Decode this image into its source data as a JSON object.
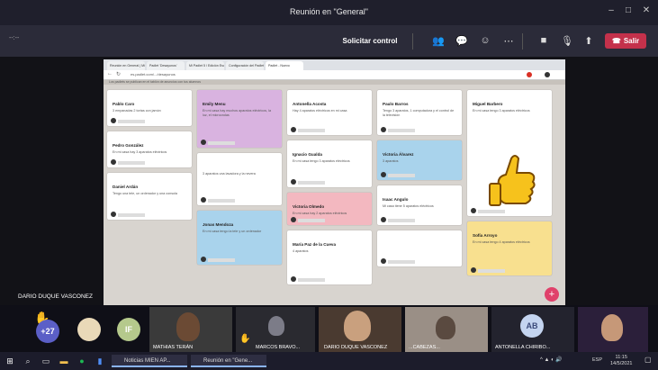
{
  "window": {
    "title": "Reunión en \"General\""
  },
  "toolbar": {
    "timer": "--:--",
    "share_label": "Solicitar control",
    "leave_label": "Salir"
  },
  "browser": {
    "tabs": [
      "Reunión en General | Microsoft Teams",
      "Padlet 'Desayunos'",
      "Mi Padlet 5 / Edición Escolar",
      "Configuración del Padlet",
      "Padlet - Nuevo"
    ],
    "url": "es.padlet.com/.../desayunos"
  },
  "padlet": {
    "header_note": "Los padlets se publican en el tablón de anuncios con tus alumnos",
    "columns": [
      [
        {
          "name": "Pablo Caro",
          "text": "3 empanadas\n2 tortas con jamón",
          "color": "white"
        },
        {
          "name": "Pedro González",
          "text": "En mi casa hay 3 aparatos eléctricos",
          "color": "white"
        },
        {
          "name": "Daniel Ardán",
          "text": "Tengo una tele, un ordenador y una consola",
          "color": "white"
        }
      ],
      [
        {
          "name": "Emily Menu",
          "text": "En mi casa hay muchos aparatos eléctricos, la luz, el microondas",
          "color": "purple"
        },
        {
          "name": "",
          "text": "3 aparatos una lavadora y la nevera",
          "color": "white"
        },
        {
          "name": "Jonas Mendoza",
          "text": "En mi casa tengo la tele y un ordenador",
          "color": "blue"
        }
      ],
      [
        {
          "name": "Antonella Acosta",
          "text": "Hay 4 aparatos eléctricos en mi casa",
          "color": "white"
        },
        {
          "name": "Ignacio Gualda",
          "text": "En mi casa tengo 3 aparatos eléctricos",
          "color": "white"
        },
        {
          "name": "Victoria Olmedo",
          "text": "En mi casa hay 2 aparatos eléctricos",
          "color": "pink"
        },
        {
          "name": "María Paz de la Cueva",
          "text": "4 aparatos",
          "color": "white"
        }
      ],
      [
        {
          "name": "Paulo Barros",
          "text": "Tengo 3 aparatos, 1 computadora y el control de la televisión",
          "color": "white"
        },
        {
          "name": "Victoria Álvarez",
          "text": "3 aparatos",
          "color": "blue"
        },
        {
          "name": "Isaac Angulo",
          "text": "Mi casa tiene 5 aparatos eléctricos",
          "color": "white"
        },
        {
          "name": "",
          "text": "",
          "color": "white"
        }
      ],
      [
        {
          "name": "Miguel Barbero",
          "text": "En mi casa tengo 3 aparatos eléctricos",
          "color": "white"
        },
        {
          "name": "Sofía Arroyo",
          "text": "En mi casa tengo 4 aparatos eléctricos",
          "color": "yellow"
        }
      ]
    ]
  },
  "presenter_label": "DARIO DUQUE VASCONEZ",
  "participants": {
    "overflow_count": "+27",
    "initials_if": "IF",
    "initials_ab": "AB",
    "names": [
      "MATHIAS TERÁN",
      "MARCOS BRAVO...",
      "DARIO DUQUE VASCONEZ",
      "...CABEZAS...",
      "ANTONELLA CHIRIBO..."
    ]
  },
  "taskbar": {
    "tasks": [
      "Noticias MIEN AP...",
      "Reunión en \"Gene..."
    ],
    "language": "ESP",
    "time": "11:15",
    "date": "14/5/2021"
  },
  "colors": {
    "white": "#ffffff",
    "purple": "#d9b3e0",
    "pink": "#f3b8c0",
    "blue": "#a9d3ec",
    "yellow": "#f8e08f",
    "leave": "#c4314b"
  }
}
